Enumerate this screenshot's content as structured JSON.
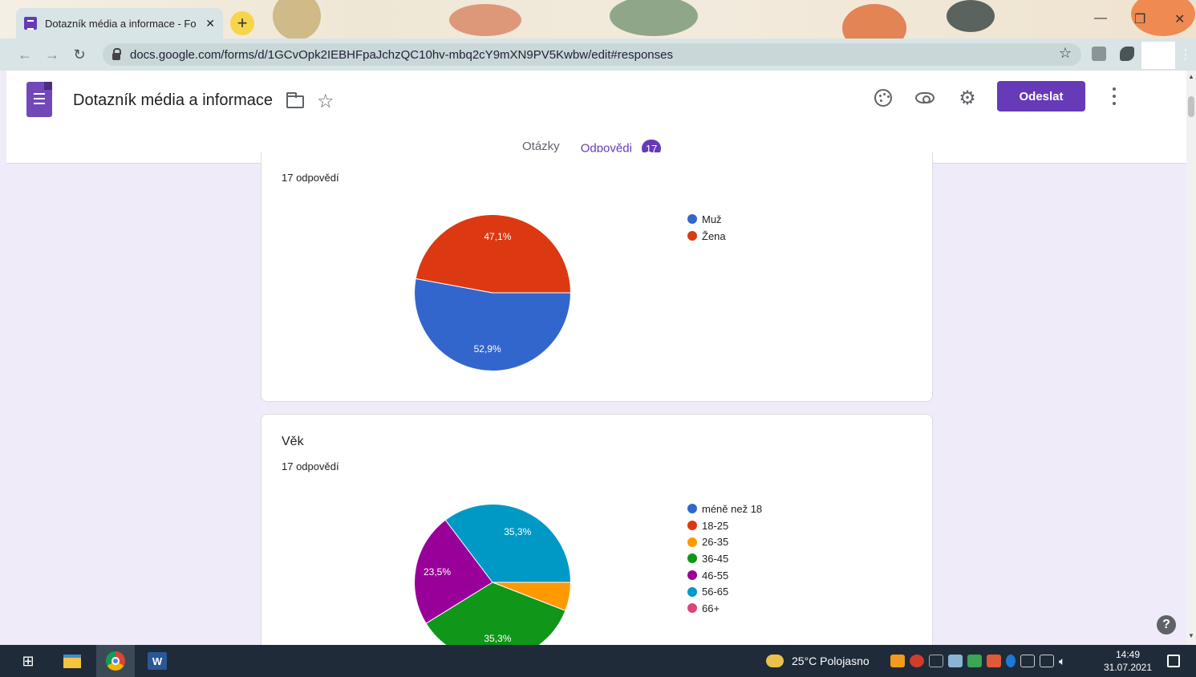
{
  "browser": {
    "tab_title": "Dotazník média a informace - Fo",
    "tab_close": "✕",
    "new_tab": "+",
    "url": "docs.google.com/forms/d/1GCvOpk2IEBHFpaJchzQC10hv-mbq2cY9mXN9PV5Kwbw/edit#responses"
  },
  "form": {
    "title": "Dotazník média a informace",
    "send_label": "Odeslat",
    "tabs": [
      {
        "label": "Otázky"
      },
      {
        "label": "Odpovědi",
        "badge": "17"
      }
    ],
    "accent": "#673ab7"
  },
  "questions": [
    {
      "title": "",
      "responses": "17 odpovědí",
      "legend": [
        {
          "label": "Muž",
          "color": "#3366cc"
        },
        {
          "label": "Žena",
          "color": "#dc3912"
        }
      ]
    },
    {
      "title": "Věk",
      "responses": "17 odpovědí",
      "legend": [
        {
          "label": "méně než 18",
          "color": "#3366cc"
        },
        {
          "label": "18-25",
          "color": "#dc3912"
        },
        {
          "label": "26-35",
          "color": "#ff9900"
        },
        {
          "label": "36-45",
          "color": "#109618"
        },
        {
          "label": "46-55",
          "color": "#990099"
        },
        {
          "label": "56-65",
          "color": "#0099c6"
        },
        {
          "label": "66+",
          "color": "#dd4477"
        }
      ]
    }
  ],
  "chart_data": [
    {
      "type": "pie",
      "categories": [
        "Muž",
        "Žena"
      ],
      "values": [
        52.9,
        47.1
      ],
      "labels": [
        "52,9%",
        "47,1%"
      ],
      "colors": [
        "#3366cc",
        "#dc3912"
      ],
      "legend": "right"
    },
    {
      "type": "pie",
      "categories": [
        "méně než 18",
        "18-25",
        "26-35",
        "36-45",
        "46-55",
        "56-65",
        "66+"
      ],
      "values": [
        0,
        0,
        5.9,
        35.3,
        23.5,
        35.3,
        0
      ],
      "labels": [
        "",
        "",
        "",
        "35,3%",
        "23,5%",
        "35,3%",
        ""
      ],
      "colors": [
        "#3366cc",
        "#dc3912",
        "#ff9900",
        "#109618",
        "#990099",
        "#0099c6",
        "#dd4477"
      ],
      "legend": "right"
    }
  ],
  "help": "?",
  "taskbar": {
    "weather": "25°C  Polojasno",
    "time": "14:49",
    "date": "31.07.2021"
  }
}
